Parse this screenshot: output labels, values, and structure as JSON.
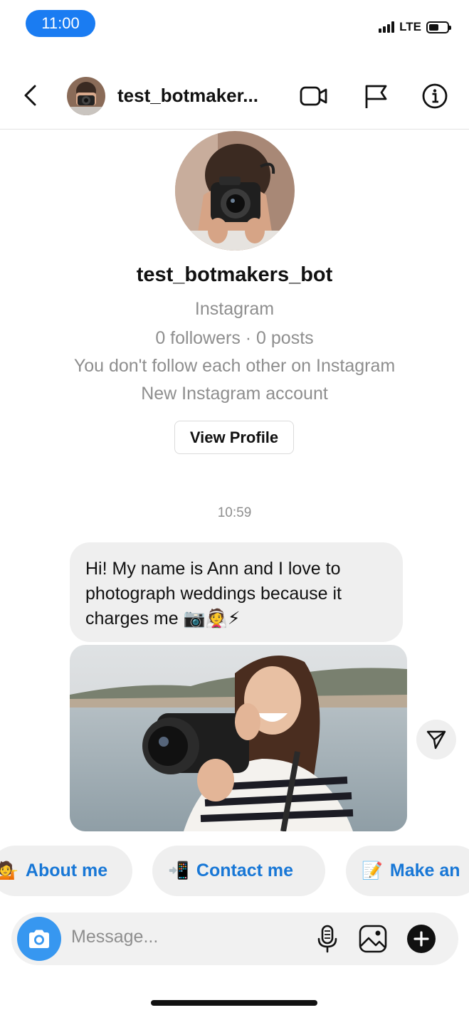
{
  "status_bar": {
    "time": "11:00",
    "network": "LTE"
  },
  "header": {
    "title": "test_botmaker...",
    "icons": [
      "back-icon",
      "video-call-icon",
      "flag-icon",
      "info-icon"
    ]
  },
  "profile": {
    "username": "test_botmakers_bot",
    "platform": "Instagram",
    "stats": "0 followers · 0 posts",
    "follow_status": "You don't follow each other on Instagram",
    "account_note": "New Instagram account",
    "view_profile_label": "View Profile"
  },
  "conversation": {
    "timestamp": "10:59",
    "message_lines": [
      "Hi! My name is Ann and I love to",
      "photograph weddings because it",
      "charges me 📷👰⚡"
    ]
  },
  "quick_replies": [
    {
      "emoji": "💁",
      "label": "About me"
    },
    {
      "emoji": "📲",
      "label": "Contact me"
    },
    {
      "emoji": "📝",
      "label": "Make an"
    }
  ],
  "composer": {
    "placeholder": "Message..."
  },
  "colors": {
    "accent": "#3797f0",
    "link": "#1877d6",
    "time_pill": "#1a7cf2"
  }
}
